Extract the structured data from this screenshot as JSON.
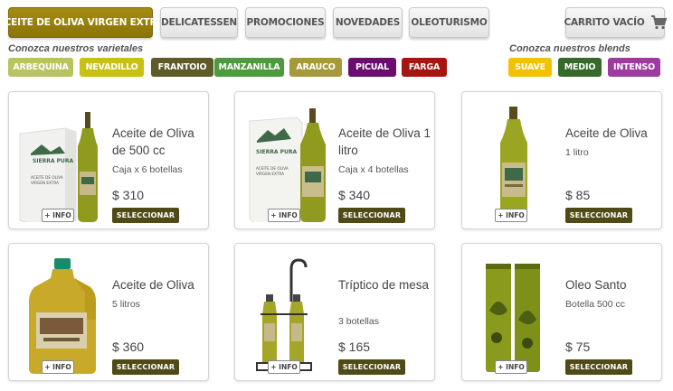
{
  "nav": {
    "tabs": [
      {
        "label": "ACEITE DE OLIVA VIRGEN EXTRA",
        "active": true
      },
      {
        "label": "DELICATESSEN"
      },
      {
        "label": "PROMOCIONES"
      },
      {
        "label": "NOVEDADES"
      },
      {
        "label": "OLEOTURISMO"
      }
    ],
    "cart_label": "CARRITO VACÍO",
    "cart_icon": "cart-icon"
  },
  "varietales": {
    "heading": "Conozca nuestros varietales",
    "items": [
      {
        "label": "ARBEQUINA",
        "color": "#b9c35f"
      },
      {
        "label": "NEVADILLO",
        "color": "#c8c014"
      },
      {
        "label": "FRANTOIO",
        "color": "#5e5b29"
      },
      {
        "label": "MANZANILLA",
        "color": "#4e9a3e"
      },
      {
        "label": "ARAUCO",
        "color": "#a49a3a"
      },
      {
        "label": "PICUAL",
        "color": "#6a0d6e"
      },
      {
        "label": "FARGA",
        "color": "#a4160f"
      }
    ]
  },
  "blends": {
    "heading": "Conozca nuestros blends",
    "items": [
      {
        "label": "SUAVE",
        "color": "#f2c200"
      },
      {
        "label": "MEDIO",
        "color": "#356a2a"
      },
      {
        "label": "INTENSO",
        "color": "#9c3c9e"
      }
    ]
  },
  "products": [
    {
      "title": "Aceite de Oliva de 500 cc",
      "subtitle": "Caja x 6 botellas",
      "price": "$ 310",
      "select": "SELECCIONAR",
      "info": "+ INFO"
    },
    {
      "title": "Aceite de Oliva 1 litro",
      "subtitle": "Caja x 4 botellas",
      "price": "$ 340",
      "select": "SELECCIONAR",
      "info": "+ INFO"
    },
    {
      "title": "Aceite de Oliva",
      "subtitle": "1 litro",
      "price": "$ 85",
      "select": "SELECCIONAR",
      "info": "+ INFO"
    },
    {
      "title": "Aceite de Oliva",
      "subtitle": "5 litros",
      "price": "$ 360",
      "select": "SELECCIONAR",
      "info": "+ INFO"
    },
    {
      "title": "Tríptico de mesa",
      "subtitle": "3 botellas",
      "price": "$ 165",
      "select": "SELECCIONAR",
      "info": "+ INFO"
    },
    {
      "title": "Oleo Santo",
      "subtitle": "Botella 500 cc",
      "price": "$ 75",
      "select": "SELECCIONAR",
      "info": "+ INFO"
    }
  ],
  "box_label": {
    "brand": "SIERRA PURA",
    "line1": "ACEITE DE OLIVA",
    "line2": "VIRGEN EXTRA"
  }
}
